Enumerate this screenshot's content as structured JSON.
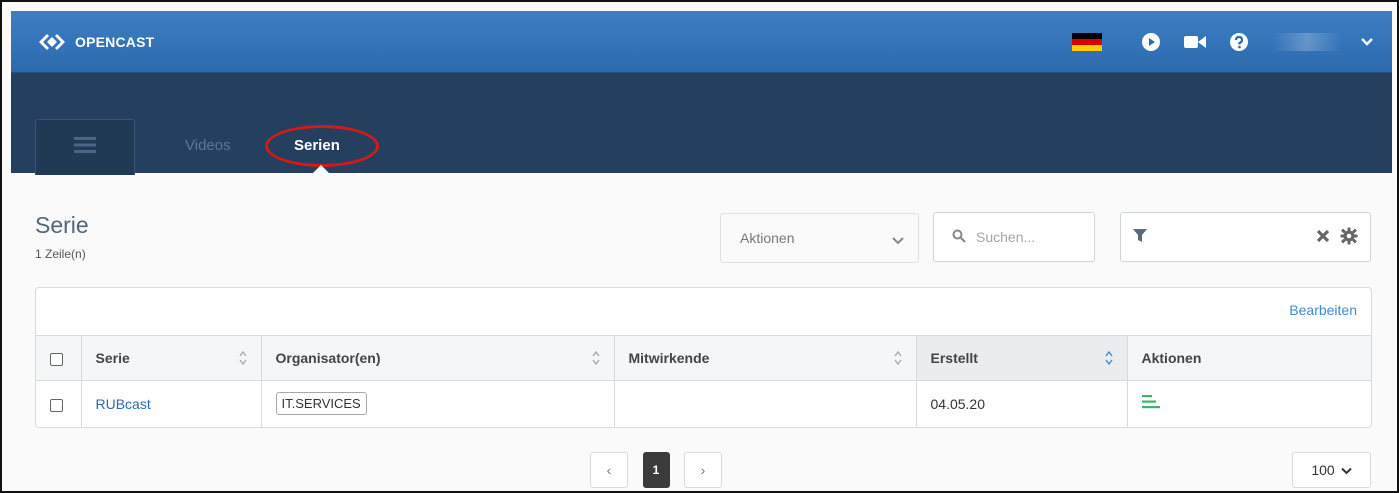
{
  "app": {
    "name": "OPENCAST"
  },
  "header": {
    "language_flag": {
      "colors": [
        "#000000",
        "#dd0000",
        "#ffce00"
      ],
      "icon": "germany-flag-icon"
    },
    "icons": [
      "play-circle-icon",
      "video-camera-icon",
      "help-circle-icon",
      "chevron-down-icon"
    ]
  },
  "nav": {
    "tabs": [
      {
        "label": "Videos",
        "active": false
      },
      {
        "label": "Serien",
        "active": true
      }
    ],
    "highlight_color": "#d11a1a"
  },
  "main": {
    "title": "Serie",
    "row_count": "1 Zeile(n)",
    "actions_label": "Aktionen",
    "search_placeholder": "Suchen...",
    "edit_link": "Bearbeiten",
    "table": {
      "columns": [
        "Serie",
        "Organisator(en)",
        "Mitwirkende",
        "Erstellt",
        "Aktionen"
      ],
      "sorted_column": "Erstellt",
      "rows": [
        {
          "serie": "RUBcast",
          "organizer": "IT.SERVICES",
          "contributors": "",
          "created": "04.05.20",
          "actions_icon": "details-bars-icon"
        }
      ]
    },
    "pagination": {
      "prev": "‹",
      "current": "1",
      "next": "›"
    },
    "page_size": "100"
  },
  "colors": {
    "topbar": "#2c6aad",
    "nav": "#24405e",
    "link": "#2c6aad",
    "accent_green": "#3bb36a"
  }
}
